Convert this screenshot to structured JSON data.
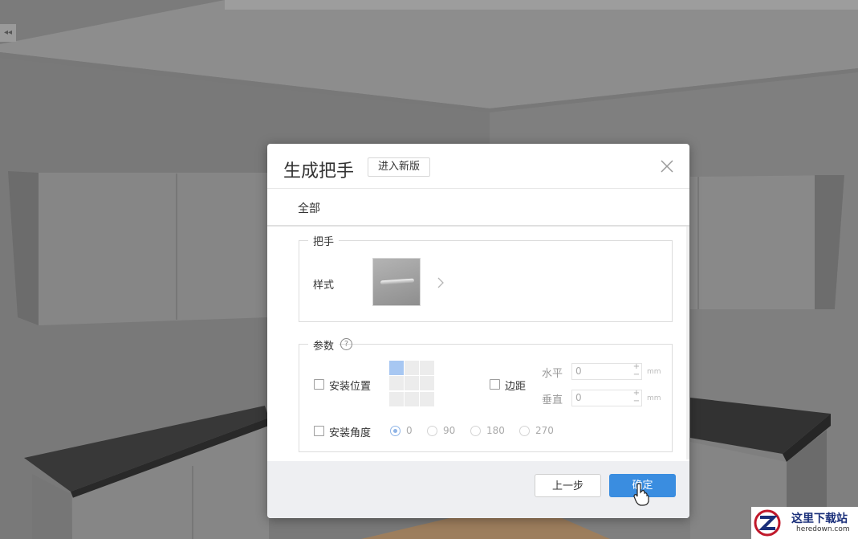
{
  "dialog": {
    "title": "生成把手",
    "new_version_button": "进入新版",
    "tab_all": "全部",
    "handle_group": {
      "legend": "把手",
      "style_label": "样式",
      "thumbnail_icon": "handle-bar-icon"
    },
    "params_group": {
      "legend": "参数",
      "install_position_label": "安装位置",
      "position_grid_selected": 0,
      "margin_label": "边距",
      "horizontal_label": "水平",
      "horizontal_value": "0",
      "vertical_label": "垂直",
      "vertical_value": "0",
      "unit": "mm",
      "install_angle_label": "安装角度",
      "angle_options": [
        "0",
        "90",
        "180",
        "270"
      ],
      "angle_selected": "0"
    },
    "footer": {
      "prev_button": "上一步",
      "confirm_button": "确定"
    }
  },
  "watermark": {
    "title": "这里下载站",
    "url": "heredown.com"
  },
  "colors": {
    "primary_button": "#3a8de0",
    "selected_cell": "#a7c7f2"
  }
}
